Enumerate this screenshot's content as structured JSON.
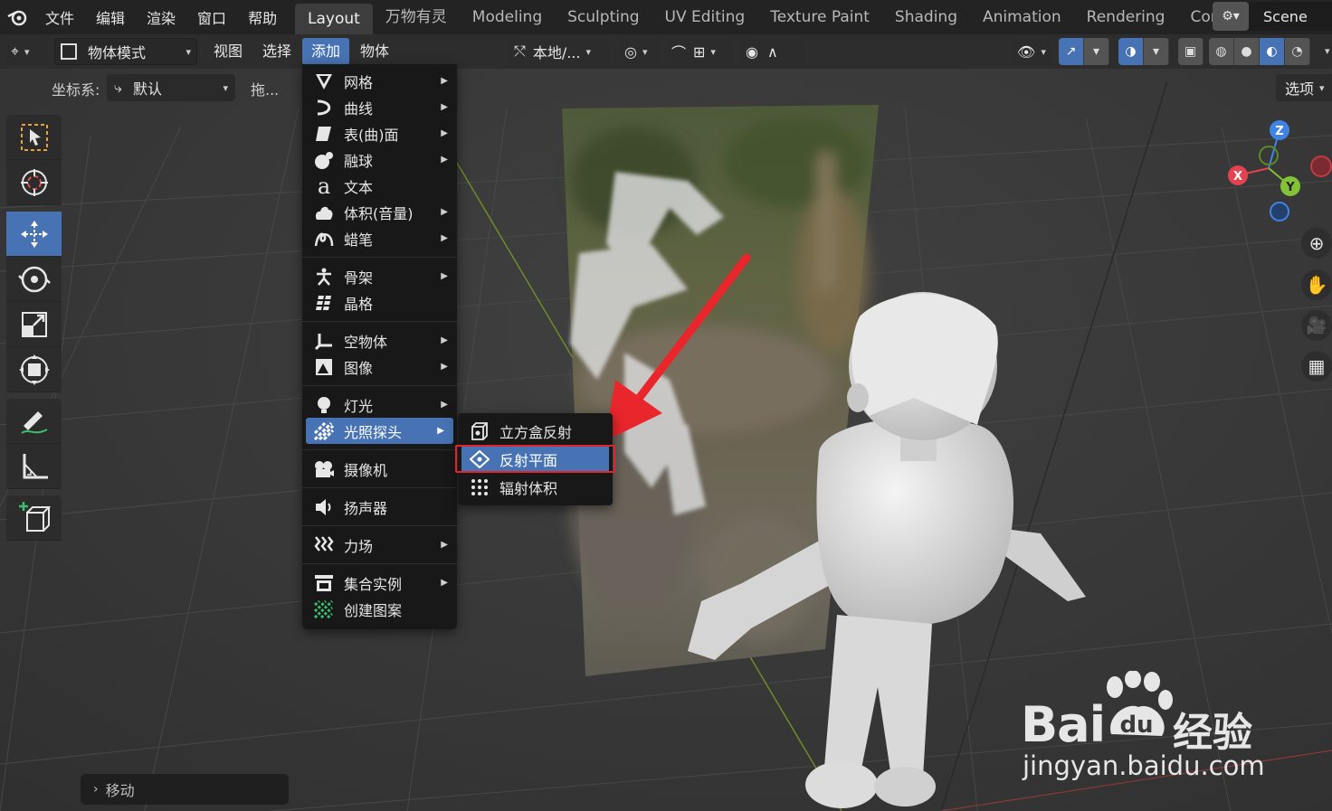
{
  "app": {
    "name": "Blender"
  },
  "topbar": {
    "menus": [
      "文件",
      "编辑",
      "渲染",
      "窗口",
      "帮助"
    ],
    "workspaces": [
      "Layout",
      "万物有灵",
      "Modeling",
      "Sculpting",
      "UV Editing",
      "Texture Paint",
      "Shading",
      "Animation",
      "Rendering",
      "Compo"
    ],
    "active_workspace": "Layout",
    "scene": "Scene"
  },
  "header": {
    "mode": "物体模式",
    "menus": [
      "视图",
      "选择",
      "添加",
      "物体"
    ],
    "active_menu": "添加",
    "transform_orientation": "本地/..."
  },
  "tool_settings": {
    "coordinate_label": "坐标系:",
    "coordinate_value": "默认",
    "drag_label": "拖...",
    "options_label": "选项"
  },
  "add_menu": {
    "items": [
      {
        "label": "网格",
        "icon": "mesh-icon",
        "submenu": true
      },
      {
        "label": "曲线",
        "icon": "curve-icon",
        "submenu": true
      },
      {
        "label": "表(曲)面",
        "icon": "surface-icon",
        "submenu": true
      },
      {
        "label": "融球",
        "icon": "metaball-icon",
        "submenu": true
      },
      {
        "label": "文本",
        "icon": "text-icon",
        "submenu": false
      },
      {
        "label": "体积(音量)",
        "icon": "volume-icon",
        "submenu": true
      },
      {
        "label": "蜡笔",
        "icon": "grease-pencil-icon",
        "submenu": true
      },
      {
        "label": "骨架",
        "icon": "armature-icon",
        "submenu": true
      },
      {
        "label": "晶格",
        "icon": "lattice-icon",
        "submenu": false
      },
      {
        "label": "空物体",
        "icon": "empty-icon",
        "submenu": true
      },
      {
        "label": "图像",
        "icon": "image-icon",
        "submenu": true
      },
      {
        "label": "灯光",
        "icon": "light-icon",
        "submenu": true
      },
      {
        "label": "光照探头",
        "icon": "light-probe-icon",
        "submenu": true,
        "highlighted": true
      },
      {
        "label": "摄像机",
        "icon": "camera-icon",
        "submenu": false
      },
      {
        "label": "扬声器",
        "icon": "speaker-icon",
        "submenu": false
      },
      {
        "label": "力场",
        "icon": "force-field-icon",
        "submenu": true
      },
      {
        "label": "集合实例",
        "icon": "collection-instance-icon",
        "submenu": true
      },
      {
        "label": "创建图案",
        "icon": "create-pattern-icon",
        "submenu": false
      }
    ]
  },
  "light_probe_submenu": {
    "items": [
      {
        "label": "立方盒反射",
        "icon": "reflection-cubemap-icon"
      },
      {
        "label": "反射平面",
        "icon": "reflection-plane-icon",
        "highlighted": true
      },
      {
        "label": "辐射体积",
        "icon": "irradiance-volume-icon"
      }
    ]
  },
  "gizmo": {
    "x": "X",
    "y": "Y",
    "z": "Z"
  },
  "last_operator": "移动",
  "watermark": {
    "brand": "Bai",
    "brand2": "经验",
    "url": "jingyan.baidu.com"
  },
  "colors": {
    "accent": "#4772b3",
    "highlight_box": "#e0262b",
    "arrow": "#e8262b"
  }
}
